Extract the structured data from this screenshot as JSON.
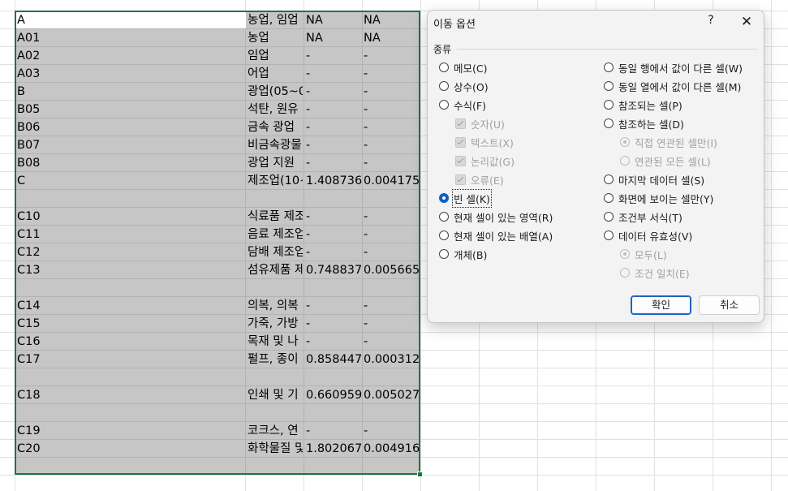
{
  "sheet": {
    "rows": [
      {
        "a": "A",
        "b": "농업, 임업",
        "c": "NA",
        "d": "NA"
      },
      {
        "a": "A01",
        "b": "농업",
        "c": "NA",
        "d": "NA"
      },
      {
        "a": "A02",
        "b": "임업",
        "c": "-",
        "d": "-"
      },
      {
        "a": "A03",
        "b": "어업",
        "c": "-",
        "d": "-"
      },
      {
        "a": "B",
        "b": "광업(05~0",
        "c": "-",
        "d": "-"
      },
      {
        "a": "B05",
        "b": "석탄, 원유",
        "c": "-",
        "d": "-"
      },
      {
        "a": "B06",
        "b": "금속 광업",
        "c": "-",
        "d": "-"
      },
      {
        "a": "B07",
        "b": "비금속광물",
        "c": "-",
        "d": "-"
      },
      {
        "a": "B08",
        "b": "광업 지원",
        "c": "-",
        "d": "-"
      },
      {
        "a": "C",
        "b": "제조업(10~",
        "c": "1.408736",
        "d": "0.004175"
      },
      {
        "a": "",
        "b": "",
        "c": "",
        "d": ""
      },
      {
        "a": "C10",
        "b": "식료품 제조",
        "c": "-",
        "d": "-"
      },
      {
        "a": "C11",
        "b": "음료 제조업",
        "c": "-",
        "d": "-"
      },
      {
        "a": "C12",
        "b": "담배 제조업",
        "c": "-",
        "d": "-"
      },
      {
        "a": "C13",
        "b": "섬유제품 제",
        "c": "0.748837",
        "d": "0.005665"
      },
      {
        "a": "",
        "b": "",
        "c": "",
        "d": ""
      },
      {
        "a": "C14",
        "b": "의복, 의복",
        "c": "-",
        "d": "-"
      },
      {
        "a": "C15",
        "b": "가죽, 가방",
        "c": "-",
        "d": "-"
      },
      {
        "a": "C16",
        "b": "목재 및 나",
        "c": "-",
        "d": "-"
      },
      {
        "a": "C17",
        "b": "펄프, 종이",
        "c": "0.858447",
        "d": "0.000312"
      },
      {
        "a": "",
        "b": "",
        "c": "",
        "d": ""
      },
      {
        "a": "C18",
        "b": "인쇄 및 기",
        "c": "0.660959",
        "d": "0.005027"
      },
      {
        "a": "",
        "b": "",
        "c": "",
        "d": ""
      },
      {
        "a": "C19",
        "b": "코크스, 연",
        "c": "-",
        "d": "-"
      },
      {
        "a": "C20",
        "b": "화학물질 및",
        "c": "1.802067",
        "d": "0.004916"
      },
      {
        "a": "",
        "b": "",
        "c": "",
        "d": ""
      }
    ],
    "selection_color": "#c6c6c6",
    "selection_border_color": "#217346"
  },
  "dialog": {
    "title": "이동 옵션",
    "help_icon": "?",
    "close_icon": "✕",
    "group_label": "종류",
    "left_options": [
      {
        "label": "메모(C)",
        "kind": "radio",
        "checked": false,
        "disabled": false,
        "indent": false
      },
      {
        "label": "상수(O)",
        "kind": "radio",
        "checked": false,
        "disabled": false,
        "indent": false
      },
      {
        "label": "수식(F)",
        "kind": "radio",
        "checked": false,
        "disabled": false,
        "indent": false
      },
      {
        "label": "숫자(U)",
        "kind": "check",
        "checked": true,
        "disabled": true,
        "indent": true
      },
      {
        "label": "텍스트(X)",
        "kind": "check",
        "checked": true,
        "disabled": true,
        "indent": true
      },
      {
        "label": "논리값(G)",
        "kind": "check",
        "checked": true,
        "disabled": true,
        "indent": true
      },
      {
        "label": "오류(E)",
        "kind": "check",
        "checked": true,
        "disabled": true,
        "indent": true
      },
      {
        "label": "빈 셀(K)",
        "kind": "radio",
        "checked": true,
        "disabled": false,
        "indent": false
      },
      {
        "label": "현재 셀이 있는 영역(R)",
        "kind": "radio",
        "checked": false,
        "disabled": false,
        "indent": false
      },
      {
        "label": "현재 셀이 있는 배열(A)",
        "kind": "radio",
        "checked": false,
        "disabled": false,
        "indent": false
      },
      {
        "label": "개체(B)",
        "kind": "radio",
        "checked": false,
        "disabled": false,
        "indent": false
      }
    ],
    "right_options": [
      {
        "label": "동일 행에서 값이 다른 셀(W)",
        "kind": "radio",
        "checked": false,
        "disabled": false,
        "indent": false
      },
      {
        "label": "동일 열에서 값이 다른 셀(M)",
        "kind": "radio",
        "checked": false,
        "disabled": false,
        "indent": false
      },
      {
        "label": "참조되는 셀(P)",
        "kind": "radio",
        "checked": false,
        "disabled": false,
        "indent": false
      },
      {
        "label": "참조하는 셀(D)",
        "kind": "radio",
        "checked": false,
        "disabled": false,
        "indent": false
      },
      {
        "label": "직접 연관된 셀만(I)",
        "kind": "radio",
        "checked": true,
        "disabled": true,
        "indent": true
      },
      {
        "label": "연관된 모든 셀(L)",
        "kind": "radio",
        "checked": false,
        "disabled": true,
        "indent": true
      },
      {
        "label": "마지막 데이터 셀(S)",
        "kind": "radio",
        "checked": false,
        "disabled": false,
        "indent": false
      },
      {
        "label": "화면에 보이는 셀만(Y)",
        "kind": "radio",
        "checked": false,
        "disabled": false,
        "indent": false
      },
      {
        "label": "조건부 서식(T)",
        "kind": "radio",
        "checked": false,
        "disabled": false,
        "indent": false
      },
      {
        "label": "데이터 유효성(V)",
        "kind": "radio",
        "checked": false,
        "disabled": false,
        "indent": false
      },
      {
        "label": "모두(L)",
        "kind": "radio",
        "checked": true,
        "disabled": true,
        "indent": true
      },
      {
        "label": "조건 일치(E)",
        "kind": "radio",
        "checked": false,
        "disabled": true,
        "indent": true
      }
    ],
    "ok_label": "확인",
    "cancel_label": "취소",
    "accent_color": "#0f5fc2"
  }
}
